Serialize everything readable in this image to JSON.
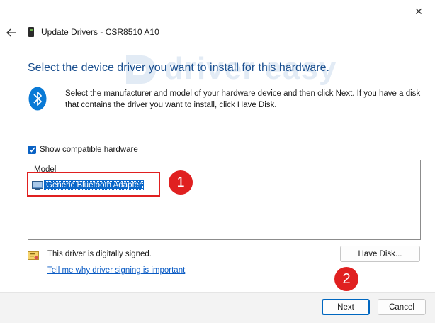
{
  "window": {
    "title": "Update Drivers - CSR8510 A10",
    "close_glyph": "✕",
    "back_glyph": "←"
  },
  "watermark": {
    "text": "driver easy"
  },
  "heading": "Select the device driver you want to install for this hardware.",
  "instructions": "Select the manufacturer and model of your hardware device and then click Next. If you have a disk that contains the driver you want to install, click Have Disk.",
  "show_compatible": {
    "label": "Show compatible hardware",
    "checked": true
  },
  "model_list": {
    "header": "Model",
    "items": [
      {
        "label": "Generic Bluetooth Adapter",
        "selected": true
      }
    ]
  },
  "annotations": {
    "badge_1": "1",
    "badge_2": "2",
    "annotation_color": "#e02020"
  },
  "signing": {
    "status": "This driver is digitally signed.",
    "link": "Tell me why driver signing is important"
  },
  "buttons": {
    "have_disk": "Have Disk...",
    "next": "Next",
    "cancel": "Cancel"
  },
  "colors": {
    "accent": "#0a67c9",
    "heading": "#1a4f8f",
    "link": "#0a5bc4"
  }
}
